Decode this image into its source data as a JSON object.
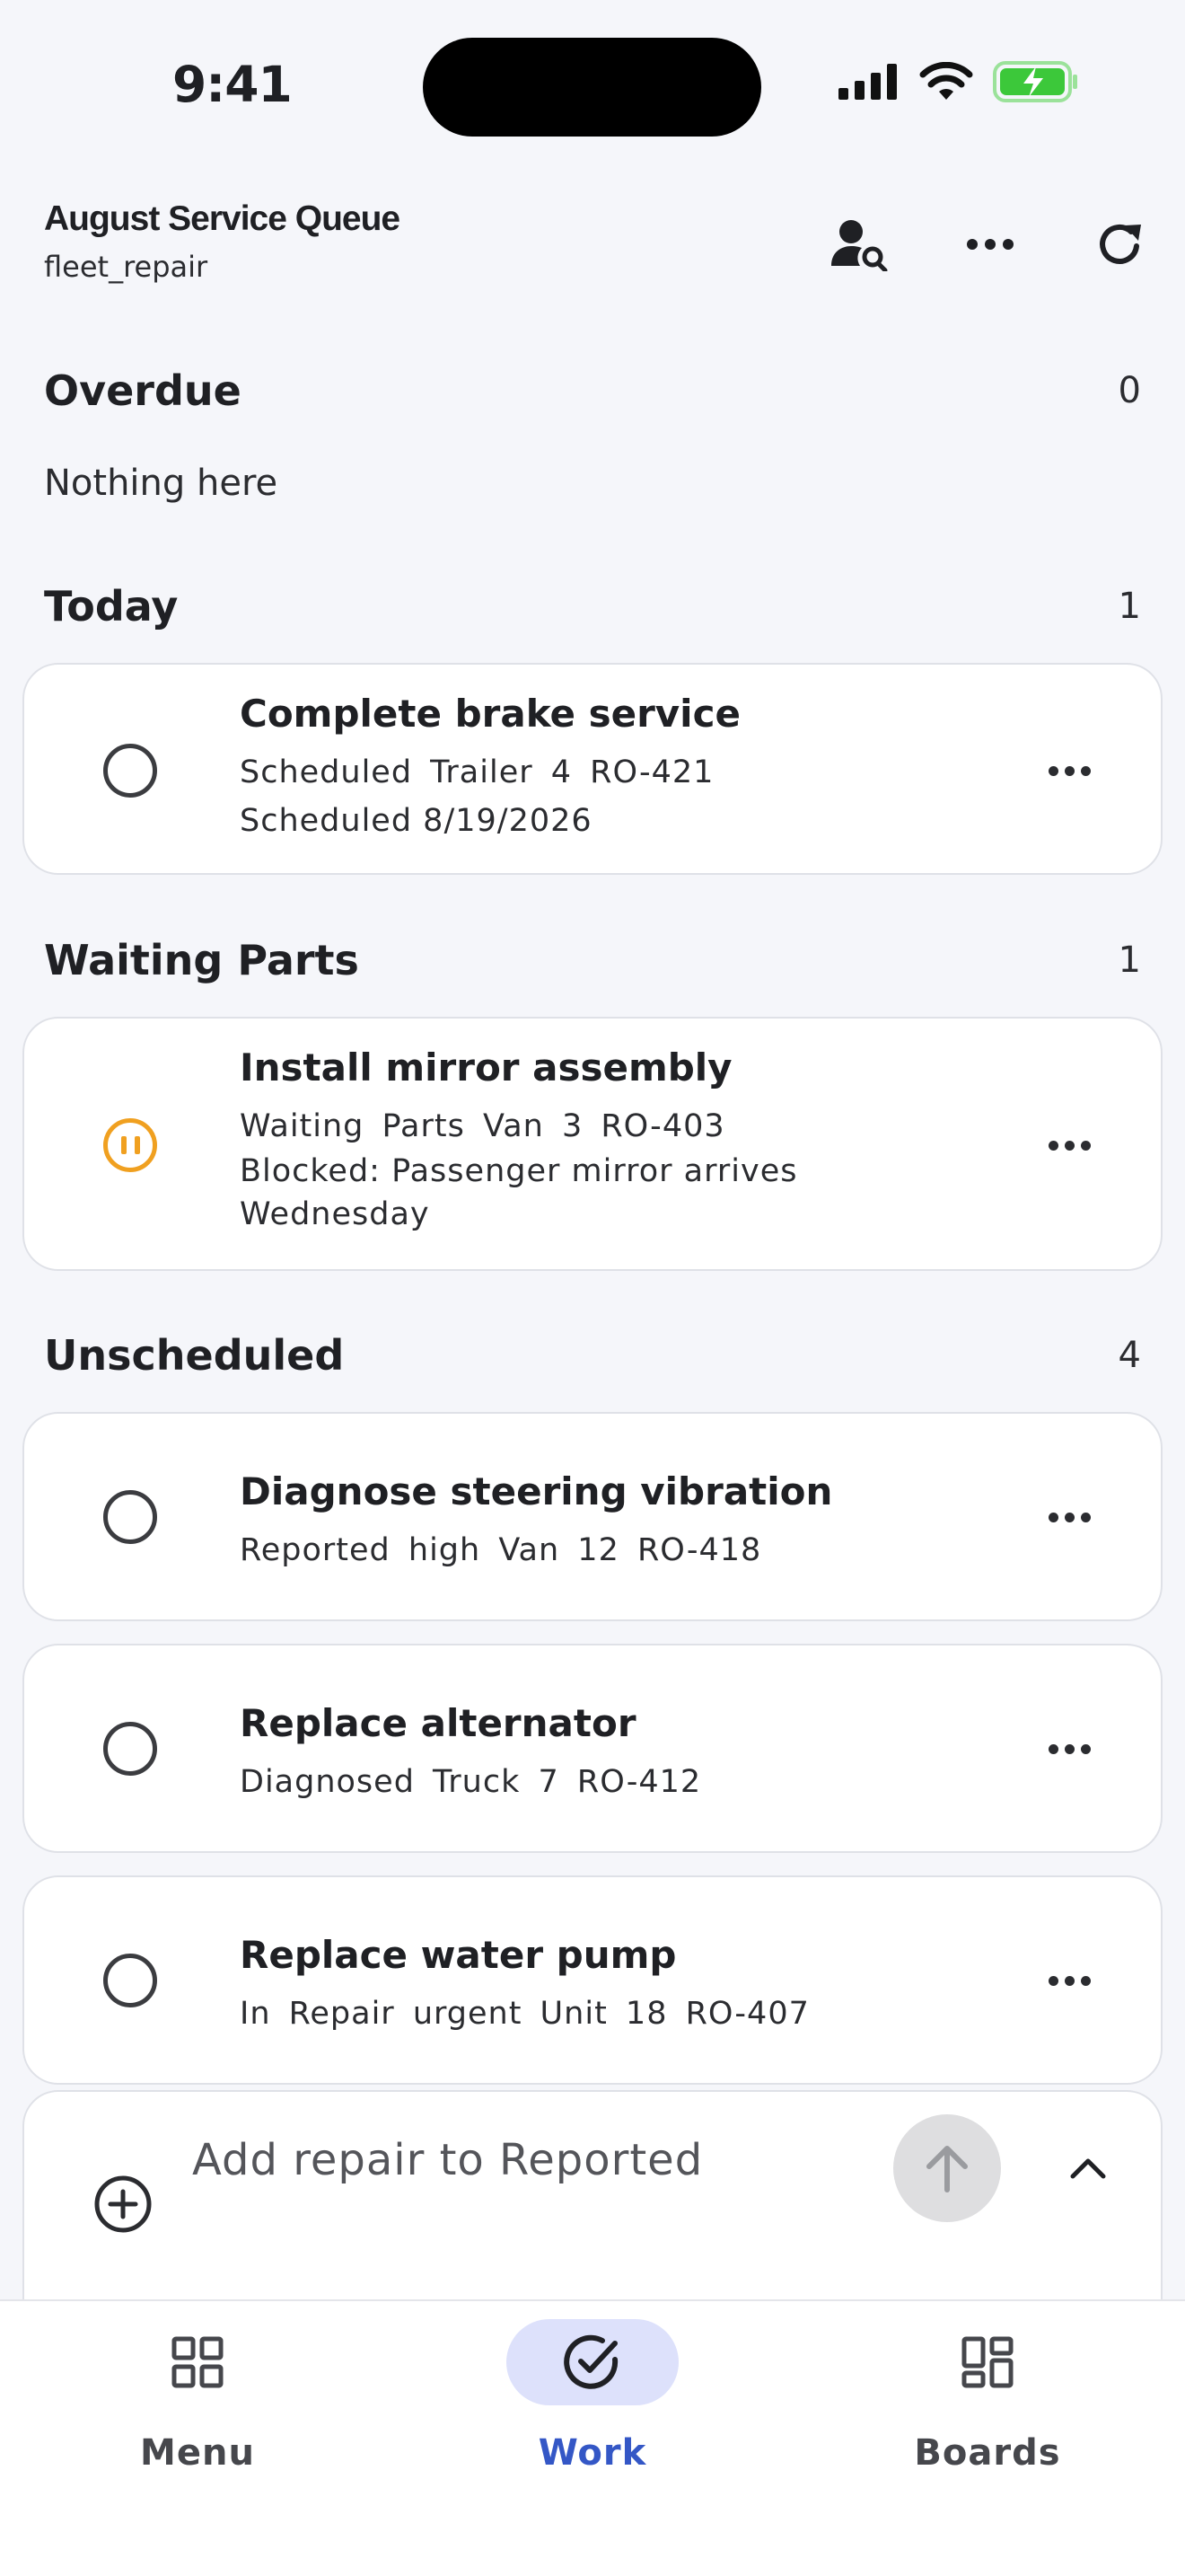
{
  "status_bar": {
    "time": "9:41"
  },
  "header": {
    "title": "August Service Queue",
    "subtitle": "fleet_repair",
    "icons": [
      "person-search-icon",
      "more-horizontal-icon",
      "refresh-icon"
    ]
  },
  "sections": {
    "overdue": {
      "title": "Overdue",
      "count": "0",
      "empty_text": "Nothing here"
    },
    "today": {
      "title": "Today",
      "count": "1"
    },
    "waiting": {
      "title": "Waiting Parts",
      "count": "1"
    },
    "unscheduled": {
      "title": "Unscheduled",
      "count": "4"
    }
  },
  "tasks": [
    {
      "title": "Complete brake service",
      "meta": "Scheduled  Trailer 4  RO-421",
      "note": "Scheduled 8/19/2026",
      "state": "open"
    },
    {
      "title": "Install mirror assembly",
      "meta": "Waiting Parts  Van 3  RO-403",
      "note": "Blocked: Passenger mirror arrives Wednesday",
      "state": "paused"
    },
    {
      "title": "Diagnose steering vibration",
      "meta": "Reported  high  Van 12  RO-418",
      "state": "open"
    },
    {
      "title": "Replace alternator",
      "meta": "Diagnosed  Truck 7  RO-412",
      "state": "open"
    },
    {
      "title": "Replace water pump",
      "meta": "In Repair  urgent  Unit 18  RO-407",
      "state": "open"
    }
  ],
  "composer": {
    "placeholder": "Add repair to Reported"
  },
  "bottom_nav": {
    "items": [
      {
        "label": "Menu",
        "icon": "grid-icon",
        "active": false
      },
      {
        "label": "Work",
        "icon": "check-circle-icon",
        "active": true
      },
      {
        "label": "Boards",
        "icon": "dashboard-icon",
        "active": false
      }
    ]
  },
  "colors": {
    "accent": "#3457c6",
    "accent_bg": "#dde1fb",
    "paused": "#f0a020",
    "background": "#f5f6fa"
  }
}
